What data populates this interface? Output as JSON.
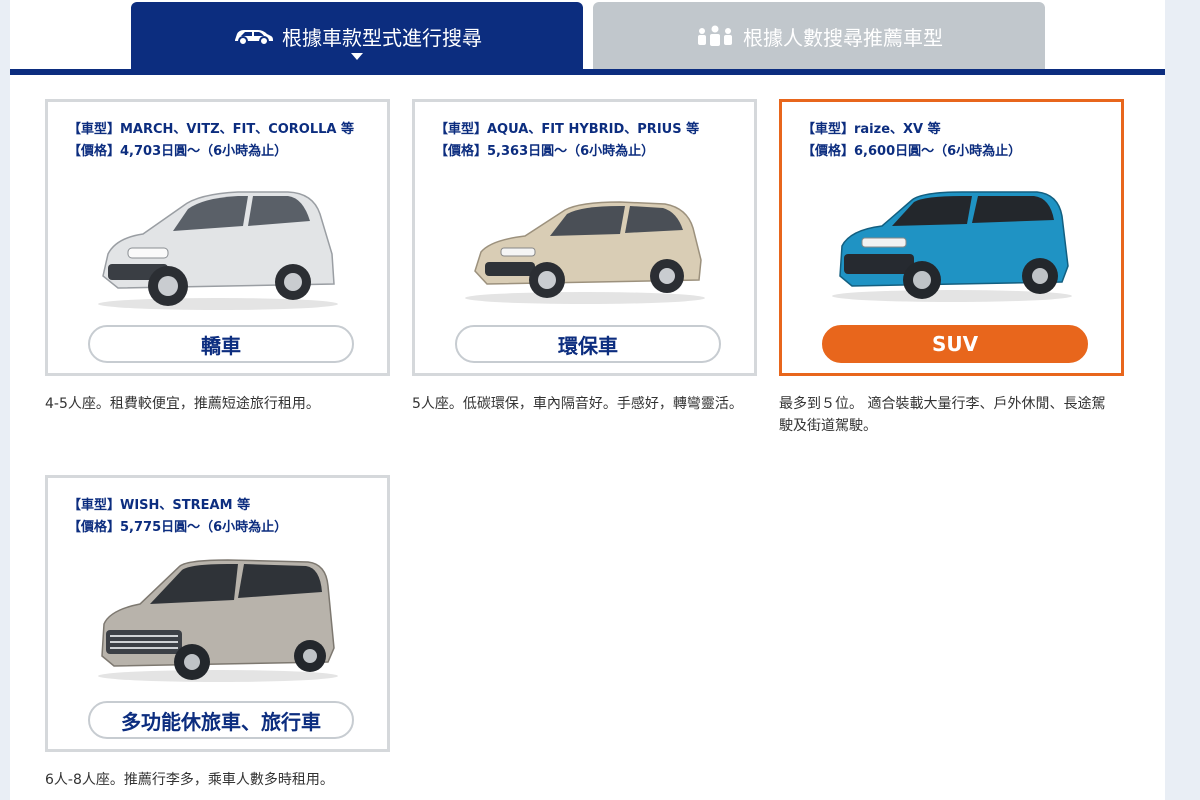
{
  "tabs": [
    {
      "label": "根據車款型式進行搜尋",
      "icon": "car-icon",
      "active": true
    },
    {
      "label": "根據人數搜尋推薦車型",
      "icon": "people-icon",
      "active": false
    }
  ],
  "cards": [
    {
      "model": "【車型】MARCH、VITZ、FIT、COROLLA 等",
      "price": "【價格】4,703日圓～（6小時為止）",
      "category": "轎車",
      "description": "4-5人座。租費較便宜，推薦短途旅行租用。",
      "car_color": "#e2e4e6",
      "selected": false
    },
    {
      "model": "【車型】AQUA、FIT HYBRID、PRIUS 等",
      "price": "【價格】5,363日圓～（6小時為止）",
      "category": "環保車",
      "description": "5人座。低碳環保，車內隔音好。手感好，轉彎靈活。",
      "car_color": "#d9cdb5",
      "selected": false
    },
    {
      "model": "【車型】raize、XV 等",
      "price": "【價格】6,600日圓～（6小時為止）",
      "category": "SUV",
      "description": "最多到５位。 適合裝載大量行李、戶外休閒、長途駕駛及街道駕駛。",
      "car_color": "#1f93c4",
      "selected": true
    },
    {
      "model": "【車型】WISH、STREAM 等",
      "price": "【價格】5,775日圓～（6小時為止）",
      "category": "多功能休旅車、旅行車",
      "description": "6人-8人座。推薦行李多，乘車人數多時租用。",
      "car_color": "#b8b3ab",
      "selected": false
    }
  ],
  "colors": {
    "primary": "#0c2d7f",
    "accent": "#e8661c",
    "tab_inactive": "#c1c7cc"
  }
}
